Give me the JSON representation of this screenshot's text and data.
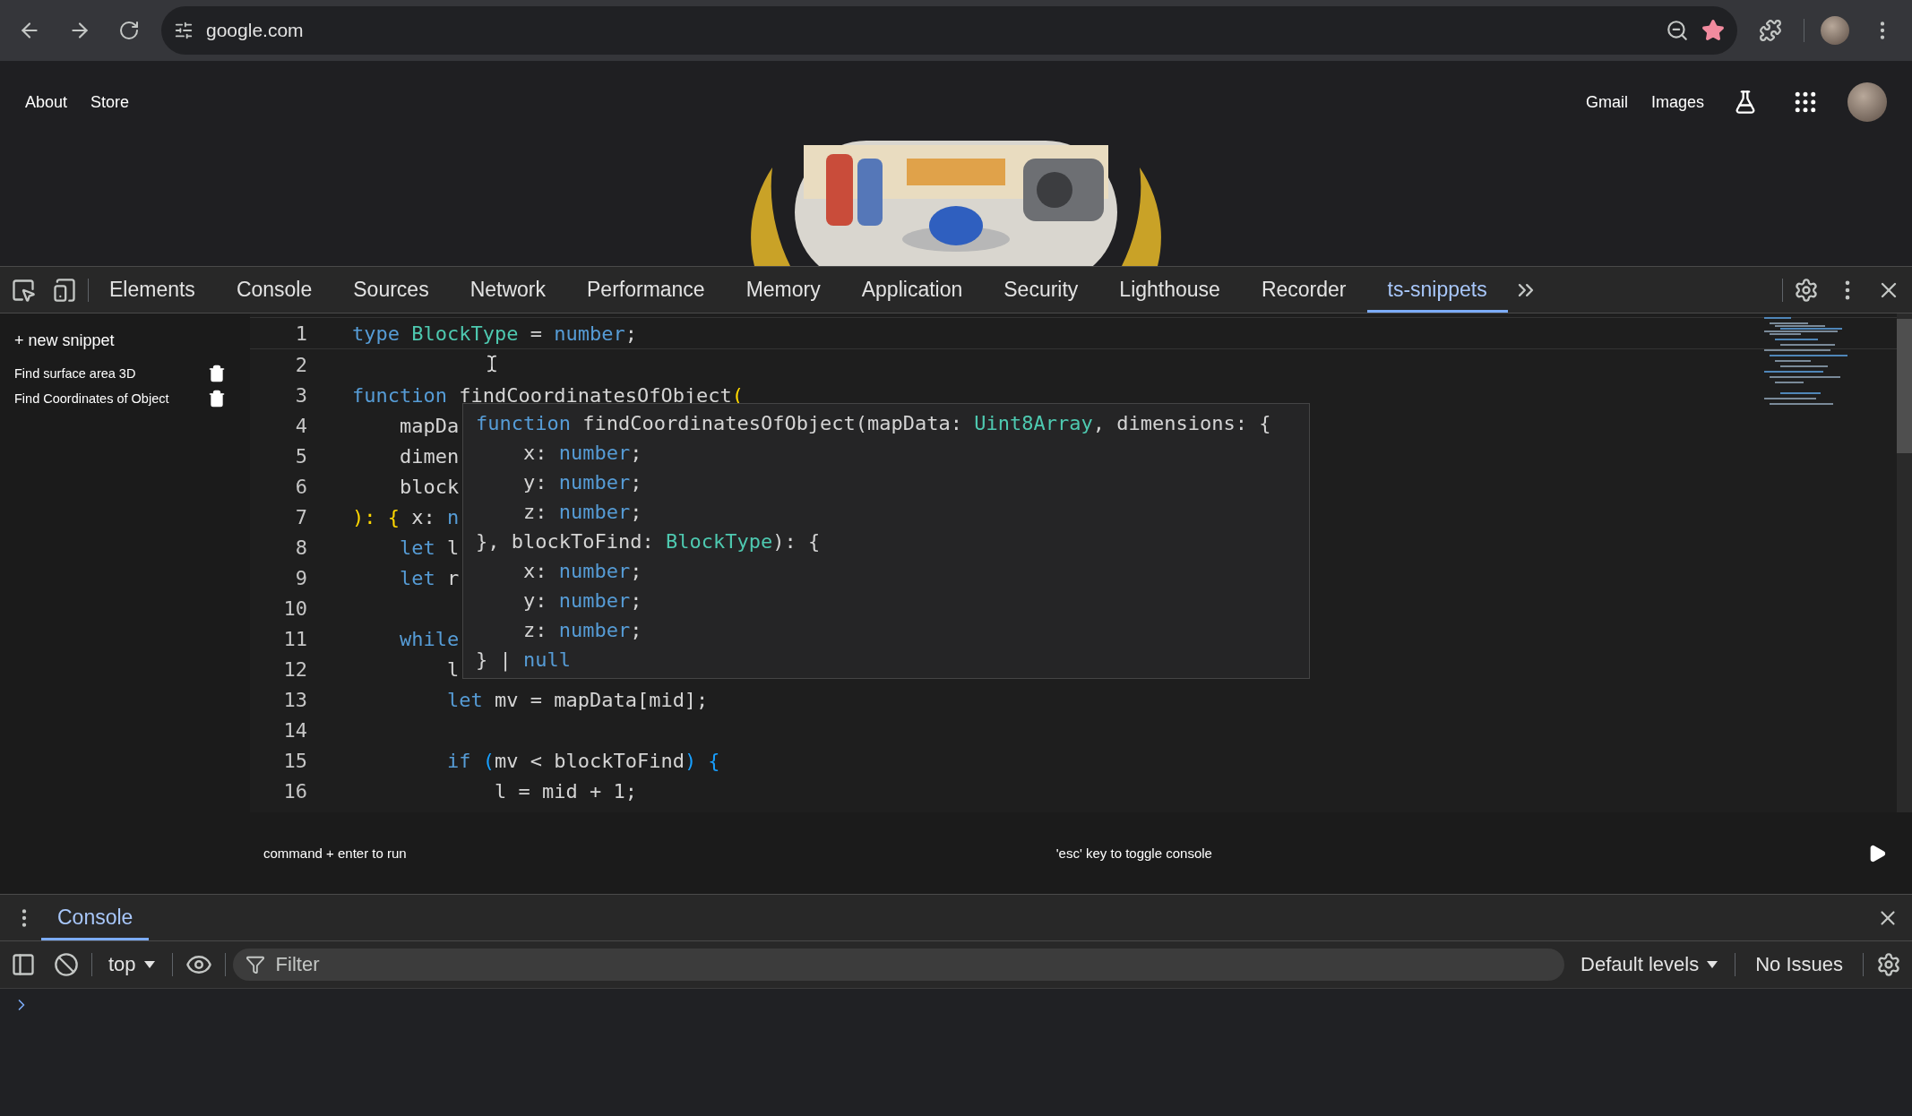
{
  "browser": {
    "url": "google.com"
  },
  "page": {
    "left_links": [
      "About",
      "Store"
    ],
    "right_links": [
      "Gmail",
      "Images"
    ]
  },
  "devtools": {
    "tabs": [
      {
        "label": "Elements",
        "selected": false
      },
      {
        "label": "Console",
        "selected": false
      },
      {
        "label": "Sources",
        "selected": false
      },
      {
        "label": "Network",
        "selected": false
      },
      {
        "label": "Performance",
        "selected": false
      },
      {
        "label": "Memory",
        "selected": false
      },
      {
        "label": "Application",
        "selected": false
      },
      {
        "label": "Security",
        "selected": false
      },
      {
        "label": "Lighthouse",
        "selected": false
      },
      {
        "label": "Recorder",
        "selected": false
      },
      {
        "label": "ts-snippets",
        "selected": true
      }
    ]
  },
  "sidebar": {
    "new_snippet": "+ new snippet",
    "snippets": [
      "Find surface area 3D",
      "Find Coordinates of Object"
    ]
  },
  "editor": {
    "lines": [
      {
        "number": "1",
        "tokens": [
          {
            "kind": "keyword",
            "text": "type "
          },
          {
            "kind": "type",
            "text": "BlockType"
          },
          {
            "kind": "plain",
            "text": " = "
          },
          {
            "kind": "keyword",
            "text": "number"
          },
          {
            "kind": "plain",
            "text": ";"
          }
        ]
      },
      {
        "number": "2"
      },
      {
        "number": "3",
        "tokens": [
          {
            "kind": "keyword",
            "text": "function"
          },
          {
            "kind": "plain",
            "text": " findCoordinatesOfObject"
          },
          {
            "kind": "bracket",
            "text": "("
          }
        ]
      },
      {
        "number": "4",
        "tokens": [
          {
            "kind": "plain",
            "text": "    mapDa"
          }
        ]
      },
      {
        "number": "5",
        "tokens": [
          {
            "kind": "plain",
            "text": "    dimen"
          }
        ]
      },
      {
        "number": "6",
        "tokens": [
          {
            "kind": "plain",
            "text": "    block"
          }
        ]
      },
      {
        "number": "7",
        "tokens": [
          {
            "kind": "bracket",
            "text": "): {"
          },
          {
            "kind": "plain",
            "text": " x: "
          },
          {
            "kind": "keyword",
            "text": "n"
          }
        ]
      },
      {
        "number": "8",
        "tokens": [
          {
            "kind": "keyword",
            "text": "    let"
          },
          {
            "kind": "plain",
            "text": " l"
          }
        ]
      },
      {
        "number": "9",
        "tokens": [
          {
            "kind": "keyword",
            "text": "    let"
          },
          {
            "kind": "plain",
            "text": " r"
          }
        ]
      },
      {
        "number": "10"
      },
      {
        "number": "11",
        "tokens": [
          {
            "kind": "keyword",
            "text": "    while"
          }
        ]
      },
      {
        "number": "12",
        "tokens": [
          {
            "kind": "plain",
            "text": "        l"
          }
        ]
      },
      {
        "number": "13",
        "tokens": [
          {
            "kind": "keyword",
            "text": "        let"
          },
          {
            "kind": "plain",
            "text": " mv = mapData[mid];"
          }
        ]
      },
      {
        "number": "14"
      },
      {
        "number": "15",
        "tokens": [
          {
            "kind": "keyword",
            "text": "        if "
          },
          {
            "kind": "bracket2",
            "text": "("
          },
          {
            "kind": "plain",
            "text": "mv < blockToFind"
          },
          {
            "kind": "bracket2",
            "text": ") {"
          }
        ]
      },
      {
        "number": "16",
        "tokens": [
          {
            "kind": "plain",
            "text": "            l = mid + 1;"
          }
        ]
      }
    ],
    "tooltip": [
      [
        {
          "kind": "keyword",
          "text": "function"
        },
        {
          "kind": "plain",
          "text": " findCoordinatesOfObject(mapData: "
        },
        {
          "kind": "type",
          "text": "Uint8Array"
        },
        {
          "kind": "plain",
          "text": ", dimensions: {"
        }
      ],
      [
        {
          "kind": "plain",
          "text": "    x: "
        },
        {
          "kind": "keyword",
          "text": "number"
        },
        {
          "kind": "plain",
          "text": ";"
        }
      ],
      [
        {
          "kind": "plain",
          "text": "    y: "
        },
        {
          "kind": "keyword",
          "text": "number"
        },
        {
          "kind": "plain",
          "text": ";"
        }
      ],
      [
        {
          "kind": "plain",
          "text": "    z: "
        },
        {
          "kind": "keyword",
          "text": "number"
        },
        {
          "kind": "plain",
          "text": ";"
        }
      ],
      [
        {
          "kind": "plain",
          "text": "}, blockToFind: "
        },
        {
          "kind": "type",
          "text": "BlockType"
        },
        {
          "kind": "plain",
          "text": "): {"
        }
      ],
      [
        {
          "kind": "plain",
          "text": "    x: "
        },
        {
          "kind": "keyword",
          "text": "number"
        },
        {
          "kind": "plain",
          "text": ";"
        }
      ],
      [
        {
          "kind": "plain",
          "text": "    y: "
        },
        {
          "kind": "keyword",
          "text": "number"
        },
        {
          "kind": "plain",
          "text": ";"
        }
      ],
      [
        {
          "kind": "plain",
          "text": "    z: "
        },
        {
          "kind": "keyword",
          "text": "number"
        },
        {
          "kind": "plain",
          "text": ";"
        }
      ],
      [
        {
          "kind": "plain",
          "text": "} | "
        },
        {
          "kind": "keyword",
          "text": "null"
        }
      ]
    ]
  },
  "footer": {
    "run_hint": "command + enter to run",
    "console_hint": "'esc' key to toggle console"
  },
  "console": {
    "tab": {
      "label": "Console",
      "selected": true
    },
    "context": "top",
    "filter_placeholder": "Filter",
    "levels": "Default levels",
    "issues": "No Issues"
  }
}
